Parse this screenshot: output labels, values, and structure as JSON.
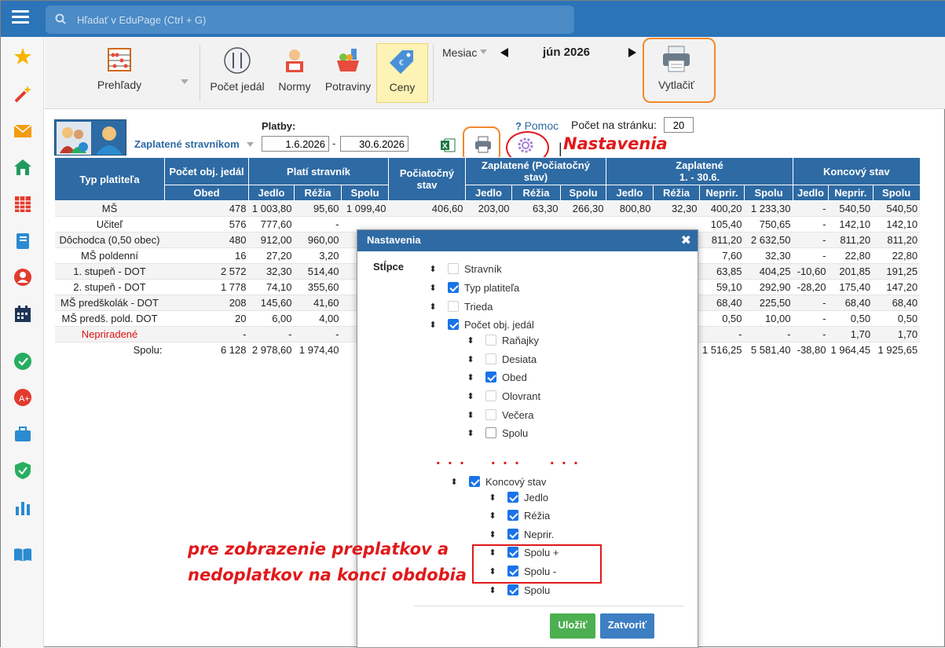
{
  "search": {
    "placeholder": "Hľadať v EduPage (Ctrl + G)"
  },
  "sidebar": {
    "icons": [
      "star-icon",
      "magic-wand-icon",
      "envelope-icon",
      "home-icon",
      "calendar-grid-icon",
      "notebook-icon",
      "user-circle-icon",
      "calendar-icon",
      "check-badge-icon",
      "grade-icon",
      "briefcase-icon",
      "shield-check-icon",
      "bar-chart-icon",
      "book-icon"
    ]
  },
  "toolbar": {
    "prehlady": "Prehľady",
    "pocet_jedal": "Počet jedál",
    "normy": "Normy",
    "potraviny": "Potraviny",
    "ceny": "Ceny",
    "mesiac_label": "Mesiac",
    "month": "jún 2026",
    "print": "Vytlačiť"
  },
  "filters": {
    "view": "Zaplatené stravníkom",
    "platby_label": "Platby:",
    "date_from": "1.6.2026",
    "date_to": "30.6.2026",
    "help": "Pomoc",
    "per_page_label": "Počet na stránku:",
    "per_page": "20"
  },
  "table": {
    "headers": {
      "typ": "Typ platiteľa",
      "pocet": "Počet obj. jedál",
      "plati": "Platí stravník",
      "pociatocny": "Počiatočný stav",
      "zaplatene_poc": "Zaplatené (Počiatočný stav)",
      "zaplatene": "Zaplatené",
      "zaplatene_range": "1. - 30.6.",
      "koncovy": "Koncový stav"
    },
    "sub": [
      "Obed",
      "Jedlo",
      "Réžia",
      "Spolu",
      "Jedlo",
      "Réžia",
      "Spolu",
      "Jedlo",
      "Réžia",
      "Neprir.",
      "Spolu",
      "Jedlo",
      "Neprir.",
      "Spolu"
    ],
    "rows": [
      {
        "n": "MŠ",
        "c": [
          "478",
          "1 003,80",
          "95,60",
          "1 099,40",
          "406,60",
          "203,00",
          "63,30",
          "266,30",
          "800,80",
          "32,30",
          "400,20",
          "1 233,30",
          "-",
          "540,50",
          "540,50"
        ]
      },
      {
        "n": "Učiteľ",
        "c": [
          "576",
          "777,60",
          "-",
          "",
          "",
          "",
          "",
          "",
          "",
          "",
          "105,40",
          "750,65",
          "-",
          "142,10",
          "142,10"
        ]
      },
      {
        "n": "Dôchodca (0,50 obec)",
        "c": [
          "480",
          "912,00",
          "960,00",
          "",
          "",
          "",
          "",
          "",
          "",
          "",
          "811,20",
          "2 632,50",
          "-",
          "811,20",
          "811,20"
        ]
      },
      {
        "n": "MŠ poldenní",
        "c": [
          "16",
          "27,20",
          "3,20",
          "",
          "",
          "",
          "",
          "",
          "",
          "",
          "7,60",
          "32,30",
          "-",
          "22,80",
          "22,80"
        ]
      },
      {
        "n": "1. stupeň - DOT",
        "c": [
          "2 572",
          "32,30",
          "514,40",
          "",
          "",
          "",
          "",
          "",
          "",
          "",
          "63,85",
          "404,25",
          "-10,60",
          "201,85",
          "191,25"
        ]
      },
      {
        "n": "2. stupeň - DOT",
        "c": [
          "1 778",
          "74,10",
          "355,60",
          "",
          "",
          "",
          "",
          "",
          "",
          "",
          "59,10",
          "292,90",
          "-28,20",
          "175,40",
          "147,20"
        ]
      },
      {
        "n": "MŠ predškolák - DOT",
        "c": [
          "208",
          "145,60",
          "41,60",
          "",
          "",
          "",
          "",
          "",
          "",
          "",
          "68,40",
          "225,50",
          "-",
          "68,40",
          "68,40"
        ]
      },
      {
        "n": "MŠ predš. pold. DOT",
        "c": [
          "20",
          "6,00",
          "4,00",
          "",
          "",
          "",
          "",
          "",
          "",
          "",
          "0,50",
          "10,00",
          "-",
          "0,50",
          "0,50"
        ]
      },
      {
        "n": "Nepriradené",
        "c": [
          "-",
          "-",
          "-",
          "",
          "",
          "",
          "",
          "",
          "",
          "",
          "-",
          "-",
          "-",
          "1,70",
          "1,70"
        ],
        "red": true
      },
      {
        "n": "Spolu:",
        "c": [
          "6 128",
          "2 978,60",
          "1 974,40",
          "",
          "",
          "",
          "",
          "",
          "",
          "",
          "1 516,25",
          "5 581,40",
          "-38,80",
          "1 964,45",
          "1 925,65"
        ],
        "sum": true
      }
    ]
  },
  "modal": {
    "title": "Nastavenia",
    "section": "Stĺpce",
    "items": [
      "Stravník",
      "Typ platiteľa",
      "Trieda",
      "Počet obj. jedál",
      "Raňajky",
      "Desiata",
      "Obed",
      "Olovrant",
      "Večera",
      "Spolu",
      "Koncový stav",
      "Jedlo",
      "Réžia",
      "Neprir.",
      "Spolu +",
      "Spolu -",
      "Spolu"
    ],
    "ellipsis": ". . .",
    "save": "Uložiť",
    "close": "Zatvoriť"
  },
  "annotations": {
    "nastavenia": "Nastavenia",
    "note_line1": "pre zobrazenie preplatkov a",
    "note_line2": "nedoplatkov na konci obdobia"
  },
  "colors": {
    "header_blue": "#2e6aa3",
    "topbar_blue": "#2b74b8",
    "annotation_red": "#e0191b",
    "highlight_orange": "#f0892c"
  }
}
